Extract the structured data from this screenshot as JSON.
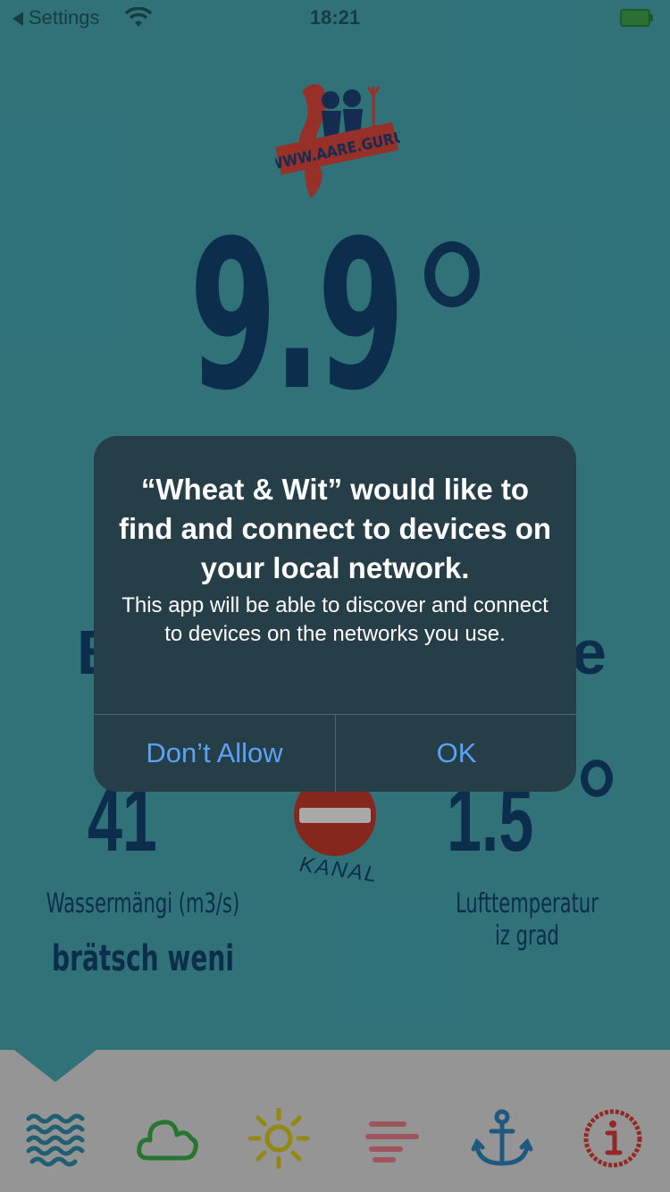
{
  "status_bar": {
    "back_label": "Settings",
    "time": "18:21"
  },
  "logo": {
    "text": "WWW.AARE.GURU"
  },
  "water_temperature": {
    "value": "9.9"
  },
  "flow": {
    "value": "41",
    "label": "Wassermängi (m3/s)",
    "description": "brätsch weni"
  },
  "kanal": {
    "label": "KANAL"
  },
  "air_temperature": {
    "value": "1.5",
    "label_line1": "Lufttemperatur",
    "label_line2": "iz grad"
  },
  "alert": {
    "title": "“Wheat & Wit” would like to find and connect to devices on your local network.",
    "message": "This app will be able to discover and connect to devices on the networks you use.",
    "dont_allow": "Don’t Allow",
    "ok": "OK"
  },
  "tabs": [
    {
      "icon": "waves-icon",
      "color": "#2f89a3"
    },
    {
      "icon": "cloud-icon",
      "color": "#3aa64a"
    },
    {
      "icon": "sun-icon",
      "color": "#d4c21b"
    },
    {
      "icon": "forecast-bars-icon",
      "color": "#e17a87"
    },
    {
      "icon": "anchor-icon",
      "color": "#2f7fb6"
    },
    {
      "icon": "info-icon",
      "color": "#d43a36"
    }
  ],
  "colors": {
    "background": "#45a4ad",
    "text_dark": "#12426e",
    "alert_bg": "#253e47",
    "alert_button": "#5aa2f5"
  }
}
